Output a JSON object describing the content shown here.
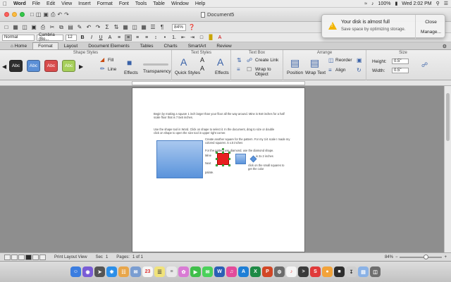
{
  "menubar": {
    "app": "Word",
    "items": [
      "File",
      "Edit",
      "View",
      "Insert",
      "Format",
      "Font",
      "Tools",
      "Table",
      "Window",
      "Help"
    ],
    "battery": "100%",
    "clock": "Wed 2:02 PM"
  },
  "window": {
    "title": "Document5"
  },
  "toolbar": {
    "zoom": "84%"
  },
  "formatting": {
    "style": "Normal",
    "font": "Cambria (Bo...",
    "size": "12"
  },
  "ribbon_tabs": [
    "Home",
    "Format",
    "Layout",
    "Document Elements",
    "Tables",
    "Charts",
    "SmartArt",
    "Review"
  ],
  "ribbon": {
    "shape_styles_title": "Shape Styles",
    "swatch_label": "Abc",
    "fill_label": "Fill",
    "line_label": "Line",
    "effects_label": "Effects",
    "transparency_label": "Transparency",
    "text_styles_title": "Text Styles",
    "quick_styles_label": "Quick Styles",
    "text_effects_label": "Effects",
    "text_box_title": "Text Box",
    "create_link_label": "Create Link",
    "wrap_to_object_label": "Wrap to Object",
    "arrange_title": "Arrange",
    "position_label": "Position",
    "wrap_text_label": "Wrap Text",
    "reorder_label": "Reorder",
    "align_label": "Align",
    "size_title": "Size",
    "height_label": "Height:",
    "height_value": "0.5\"",
    "width_label": "Width:",
    "width_value": "0.5\""
  },
  "document": {
    "para1": "Begin by making a square 1 inch larger than your floor all the way around. Mine is 9x8 inches for a half scale floor that is 7.5x6 inches.",
    "para2": "Use the shape tool in Word. Click on shape to select it. In the document, drag to size or double click on shape to open the size tool in upper right corner.",
    "para3": "Create another square for the pattern. For my 1/4 scale I made my colored squares .5 x.5 inches",
    "para4": "For the pattern use diamond, use the diamond shape.",
    "mine_label": "Mine",
    "mine_size": "is 2x 2 inches",
    "next_label": "Next",
    "next_text": "click on the small squares to get the color",
    "palate_label": "palate."
  },
  "statusbar": {
    "view": "Print Layout View",
    "sec_label": "Sec",
    "sec_value": "1",
    "pages_label": "Pages:",
    "pages_value": "1 of 1",
    "zoom": "84%"
  },
  "notification": {
    "title": "Your disk is almost full",
    "body": "Save space by optimizing storage.",
    "close_label": "Close",
    "manage_label": "Manage..."
  },
  "colors": {
    "accent": "#3a62a8",
    "shape_blue": "#5a93db",
    "shape_red": "#e82020",
    "warning": "#f2b400"
  }
}
